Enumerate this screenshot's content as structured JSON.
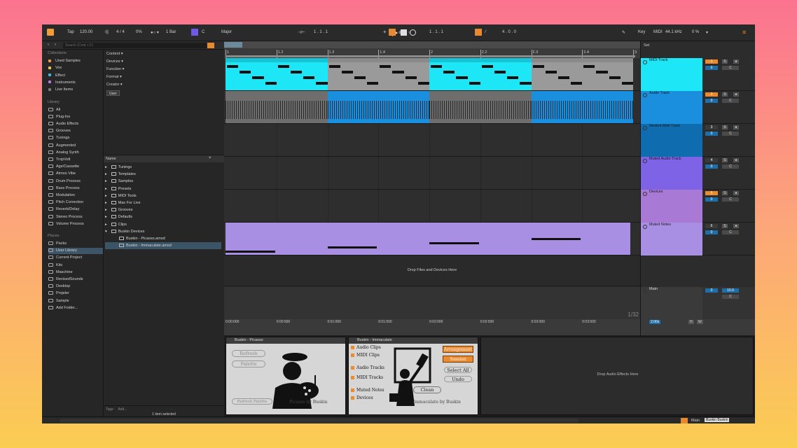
{
  "topbar": {
    "tap": "Tap",
    "tempo": "120.00",
    "signature": "4 / 4",
    "cpu": "0%",
    "quant": "1 Bar",
    "key": "C",
    "scale": "Major",
    "pos1": "1 .  1 .  1",
    "pos2": "1 .  1 .  1",
    "pos3": "4 .  0 .  0",
    "key_label": "Key",
    "midi": "MIDI",
    "samplerate": "44.1 kHz",
    "load": "0 %"
  },
  "browser": {
    "search_placeholder": "Search (Cmd + F)",
    "collections_title": "Collections",
    "collections": [
      {
        "label": "Used Samples",
        "color": "#f29b3b"
      },
      {
        "label": "Vox",
        "color": "#e5c64a"
      },
      {
        "label": "Effect",
        "color": "#3fb5e6"
      },
      {
        "label": "Instruments",
        "color": "#b277e0"
      },
      {
        "label": "Live Items",
        "color": "#7a7a7a"
      }
    ],
    "library_title": "Library",
    "library": [
      "All",
      "Plug-Ins",
      "Audio Effects",
      "Grooves",
      "Tunings",
      "Augmented",
      "Analog Synth",
      "TropVolt",
      "Age/Cassette",
      "Atmos Vibe",
      "Drum Process",
      "Bass Process",
      "Modulation",
      "Pitch Correction",
      "Reverb/Delay",
      "Stereo Process",
      "Volume Process"
    ],
    "places_title": "Places",
    "places": [
      "Packs",
      "User Library",
      "Current Project",
      "Kits",
      "Maschine",
      "RevisedSounds",
      "Desktop",
      "Projeler",
      "Sample",
      "Add Folder..."
    ],
    "filters": [
      "Content",
      "Devices",
      "Function",
      "Format",
      "Creator"
    ],
    "user_chip": "User",
    "files_header": "Name",
    "files": [
      "Tunings",
      "Templates",
      "Samples",
      "Presets",
      "MIDI Tools",
      "Max For Live",
      "Grooves",
      "Defaults",
      "Clips",
      "Buskin Devices"
    ],
    "subfiles": [
      "Buskin - Picasso.amxd",
      "Buskin - Immaculate.amxd"
    ],
    "tags_label": "Tags:",
    "tags_placeholder": "Add...",
    "selected_info": "1 item selected"
  },
  "ruler": {
    "bars": [
      "1",
      "1.2",
      "1.3",
      "1.4",
      "2",
      "2.2",
      "2.3",
      "2.4",
      "3"
    ],
    "times": [
      "0:00:000",
      "0:00:500",
      "0:01:000",
      "0:01:500",
      "0:02:000",
      "0:02:500",
      "0:03:000",
      "0:03:500"
    ]
  },
  "tracks": [
    {
      "name": "MIDI Track",
      "num": "1",
      "color": "#1de6f7",
      "mcolor": "#1de6f7",
      "h": 47
    },
    {
      "name": "Audio Track",
      "num": "2",
      "color": "#1a8fdd",
      "mcolor": "#1a8fdd",
      "h": 47
    },
    {
      "name": "Nested Midi Track",
      "num": "3",
      "color": "#0f6cae",
      "mcolor": "#0f6cae",
      "h": 47
    },
    {
      "name": "Muted Audio Track",
      "num": "4",
      "color": "#7e63e6",
      "mcolor": "#7e63e6",
      "h": 47
    },
    {
      "name": "Devices",
      "num": "5",
      "color": "#b07fdc",
      "mcolor": "#a87ad6",
      "h": 47
    },
    {
      "name": "Muted Notes",
      "num": "6",
      "color": "#a98fe3",
      "mcolor": "#a98fe3",
      "h": 47
    }
  ],
  "arrangement": {
    "drop_text": "Drop Files and Devices Here",
    "zoom": "1/32",
    "loop_label": "2.00s"
  },
  "main_track": {
    "name": "Main",
    "vol": "0",
    "pan": "C",
    "val": "10.0"
  },
  "mixer": {
    "set": "Set",
    "zero": "0",
    "pan": "C",
    "s": "S",
    "h": "H",
    "w": "W"
  },
  "devices": {
    "picasso": {
      "title": "Buskin - Picasso",
      "refresh": "Refresh",
      "palette": "Palette",
      "refresh_palette": "Refresh Palette",
      "footer": "Picasso by Buskin"
    },
    "immaculate": {
      "title": "Buskin - Immaculate",
      "checks": [
        "Audio Clips",
        "MIDI Clips",
        "Audio Tracks",
        "MIDI Tracks",
        "Muted Notes",
        "Devices"
      ],
      "arrangement": "Arrangement",
      "session": "Session",
      "select_all": "Select All",
      "undo": "Undo",
      "clean": "Clean",
      "footer": "Immaculate by Buskin"
    },
    "drop_fx": "Drop Audio Effects Here"
  },
  "status": {
    "main": "Main",
    "track": "Buskin Buskin"
  }
}
